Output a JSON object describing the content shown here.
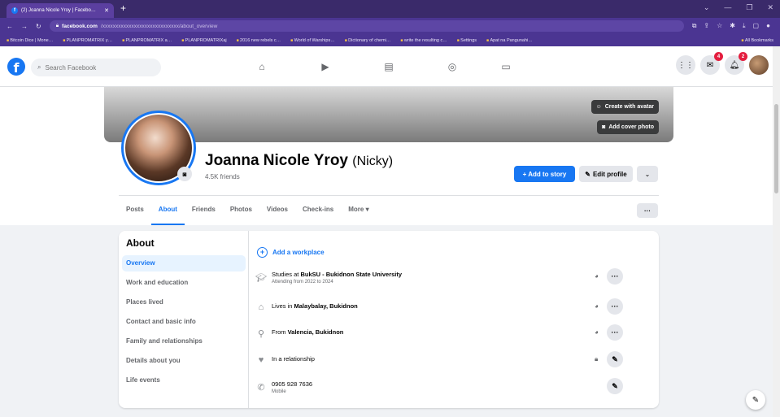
{
  "browser": {
    "tab_title": "(2) Joanna Nicole Yroy | Facebo…",
    "tab_close": "✕",
    "new_tab": "+",
    "url_host": "facebook.com",
    "url_path": "/xxxxxxxxxxxxxxxxxxxxxxxxxxxxx/about_overview",
    "bookmarks": [
      "Bitcoin Dice | Mone…",
      "PLANPROMATRIX y…",
      "PLANPROMATRIX a…",
      "PLANPROMATRIXaj",
      "2016 new rebels c…",
      "World of Warships…",
      "Dictionary of chemi…",
      "write the resulting c…",
      "Settings",
      "Apat na Pangunahi…"
    ],
    "all_bookmarks": "All Bookmarks"
  },
  "fbnav": {
    "logo": "f",
    "search_placeholder": "Search Facebook",
    "messenger_badge": "4",
    "notif_badge": "2"
  },
  "profile": {
    "name": "Joanna Nicole Yroy",
    "nickname": "(Nicky)",
    "friends": "4.5K friends",
    "create_avatar": "Create with avatar",
    "add_cover": "Add cover photo",
    "add_story": "+ Add to story",
    "edit_profile": "Edit profile",
    "more_dropdown": "⌄",
    "tabs": [
      "Posts",
      "About",
      "Friends",
      "Photos",
      "Videos",
      "Check-ins",
      "More ▾"
    ],
    "tab_more_menu": "···"
  },
  "about": {
    "title": "About",
    "sections": [
      "Overview",
      "Work and education",
      "Places lived",
      "Contact and basic info",
      "Family and relationships",
      "Details about you",
      "Life events"
    ],
    "add_workplace": "Add a workplace",
    "studies_prefix": "Studies at ",
    "studies_school": "BukSU - Bukidnon State University",
    "studies_sub": "Attending from 2022 to 2024",
    "lives_prefix": "Lives in ",
    "lives_place": "Malaybalay, Bukidnon",
    "from_prefix": "From ",
    "from_place": "Valencia, Bukidnon",
    "relationship": "In a relationship",
    "phone": "0905 928 7636",
    "phone_sub": "Mobile"
  },
  "colors": {
    "accent": "#1877f2",
    "browser_frame": "#4b3592",
    "badge": "#e41e3f"
  }
}
